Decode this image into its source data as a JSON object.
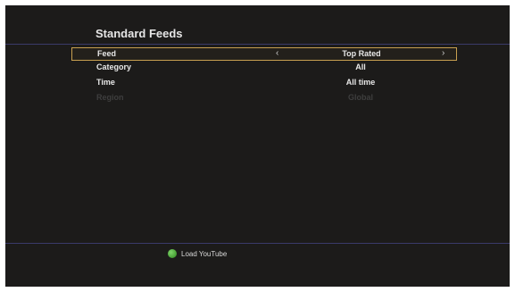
{
  "header": {
    "title": "Standard Feeds"
  },
  "settings": {
    "rows": [
      {
        "label": "Feed",
        "value": "Top Rated",
        "prev_icon": "chevron-left-icon",
        "next_icon": "chevron-right-icon",
        "prev_glyph": "‹",
        "next_glyph": "›",
        "selected": true,
        "enabled": true
      },
      {
        "label": "Category",
        "value": "All",
        "selected": false,
        "enabled": true
      },
      {
        "label": "Time",
        "value": "All time",
        "selected": false,
        "enabled": true
      },
      {
        "label": "Region",
        "value": "Global",
        "selected": false,
        "enabled": false
      }
    ]
  },
  "footer": {
    "button_label": "Load YouTube",
    "button_icon": "green-button-icon",
    "button_color": "#3ea82a"
  },
  "colors": {
    "background": "#1c1b1a",
    "divider": "#3a3a6a",
    "selection_border": "#c8a050",
    "text": "#e8e8e8",
    "disabled_text": "#3e3e3e"
  }
}
